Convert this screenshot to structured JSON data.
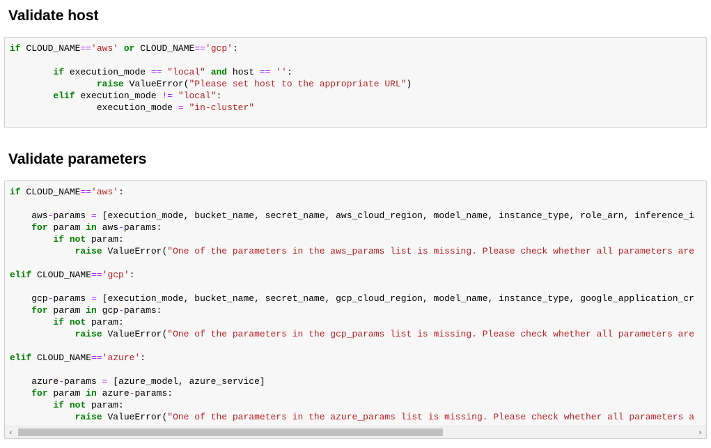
{
  "sections": [
    {
      "title": "Validate host"
    },
    {
      "title": "Validate parameters"
    }
  ],
  "code_cells": [
    {
      "lines": [
        [
          [
            "kw",
            "if"
          ],
          [
            "t",
            " CLOUD_NAME"
          ],
          [
            "op",
            "=="
          ],
          [
            "str",
            "'aws'"
          ],
          [
            "t",
            " "
          ],
          [
            "kw",
            "or"
          ],
          [
            "t",
            " CLOUD_NAME"
          ],
          [
            "op",
            "=="
          ],
          [
            "str",
            "'gcp'"
          ],
          [
            "t",
            ":"
          ]
        ],
        [],
        [
          [
            "t",
            "        "
          ],
          [
            "kw",
            "if"
          ],
          [
            "t",
            " execution_mode "
          ],
          [
            "op",
            "=="
          ],
          [
            "t",
            " "
          ],
          [
            "str",
            "\"local\""
          ],
          [
            "t",
            " "
          ],
          [
            "kw",
            "and"
          ],
          [
            "t",
            " host "
          ],
          [
            "op",
            "=="
          ],
          [
            "t",
            " "
          ],
          [
            "str",
            "''"
          ],
          [
            "t",
            ":"
          ]
        ],
        [
          [
            "t",
            "                "
          ],
          [
            "kw",
            "raise"
          ],
          [
            "t",
            " ValueError("
          ],
          [
            "str",
            "\"Please set host to the appropriate URL\""
          ],
          [
            "t",
            ")"
          ]
        ],
        [
          [
            "t",
            "        "
          ],
          [
            "kw",
            "elif"
          ],
          [
            "t",
            " execution_mode "
          ],
          [
            "op",
            "!="
          ],
          [
            "t",
            " "
          ],
          [
            "str",
            "\"local\""
          ],
          [
            "t",
            ":"
          ]
        ],
        [
          [
            "t",
            "                execution_mode "
          ],
          [
            "op",
            "="
          ],
          [
            "t",
            " "
          ],
          [
            "str",
            "\"in-cluster\""
          ]
        ]
      ]
    },
    {
      "lines": [
        [
          [
            "kw",
            "if"
          ],
          [
            "t",
            " CLOUD_NAME"
          ],
          [
            "op",
            "=="
          ],
          [
            "str",
            "'aws'"
          ],
          [
            "t",
            ":"
          ]
        ],
        [],
        [
          [
            "t",
            "    aws"
          ],
          [
            "op",
            "-"
          ],
          [
            "t",
            "params "
          ],
          [
            "op",
            "="
          ],
          [
            "t",
            " [execution_mode, bucket_name, secret_name, aws_cloud_region, model_name, instance_type, role_arn, inference_i"
          ]
        ],
        [
          [
            "t",
            "    "
          ],
          [
            "kw",
            "for"
          ],
          [
            "t",
            " param "
          ],
          [
            "kw",
            "in"
          ],
          [
            "t",
            " aws"
          ],
          [
            "op",
            "-"
          ],
          [
            "t",
            "params:"
          ]
        ],
        [
          [
            "t",
            "        "
          ],
          [
            "kw",
            "if"
          ],
          [
            "t",
            " "
          ],
          [
            "kw",
            "not"
          ],
          [
            "t",
            " param:"
          ]
        ],
        [
          [
            "t",
            "            "
          ],
          [
            "kw",
            "raise"
          ],
          [
            "t",
            " ValueError("
          ],
          [
            "str",
            "\"One of the parameters in the aws_params list is missing. Please check whether all parameters are"
          ]
        ],
        [],
        [
          [
            "kw",
            "elif"
          ],
          [
            "t",
            " CLOUD_NAME"
          ],
          [
            "op",
            "=="
          ],
          [
            "str",
            "'gcp'"
          ],
          [
            "t",
            ":"
          ]
        ],
        [],
        [
          [
            "t",
            "    gcp"
          ],
          [
            "op",
            "-"
          ],
          [
            "t",
            "params "
          ],
          [
            "op",
            "="
          ],
          [
            "t",
            " [execution_mode, bucket_name, secret_name, gcp_cloud_region, model_name, instance_type, google_application_cr"
          ]
        ],
        [
          [
            "t",
            "    "
          ],
          [
            "kw",
            "for"
          ],
          [
            "t",
            " param "
          ],
          [
            "kw",
            "in"
          ],
          [
            "t",
            " gcp"
          ],
          [
            "op",
            "-"
          ],
          [
            "t",
            "params:"
          ]
        ],
        [
          [
            "t",
            "        "
          ],
          [
            "kw",
            "if"
          ],
          [
            "t",
            " "
          ],
          [
            "kw",
            "not"
          ],
          [
            "t",
            " param:"
          ]
        ],
        [
          [
            "t",
            "            "
          ],
          [
            "kw",
            "raise"
          ],
          [
            "t",
            " ValueError("
          ],
          [
            "str",
            "\"One of the parameters in the gcp_params list is missing. Please check whether all parameters are"
          ]
        ],
        [],
        [
          [
            "kw",
            "elif"
          ],
          [
            "t",
            " CLOUD_NAME"
          ],
          [
            "op",
            "=="
          ],
          [
            "str",
            "'azure'"
          ],
          [
            "t",
            ":"
          ]
        ],
        [],
        [
          [
            "t",
            "    azure"
          ],
          [
            "op",
            "-"
          ],
          [
            "t",
            "params "
          ],
          [
            "op",
            "="
          ],
          [
            "t",
            " [azure_model, azure_service]"
          ]
        ],
        [
          [
            "t",
            "    "
          ],
          [
            "kw",
            "for"
          ],
          [
            "t",
            " param "
          ],
          [
            "kw",
            "in"
          ],
          [
            "t",
            " azure"
          ],
          [
            "op",
            "-"
          ],
          [
            "t",
            "params:"
          ]
        ],
        [
          [
            "t",
            "        "
          ],
          [
            "kw",
            "if"
          ],
          [
            "t",
            " "
          ],
          [
            "kw",
            "not"
          ],
          [
            "t",
            " param:"
          ]
        ],
        [
          [
            "t",
            "            "
          ],
          [
            "kw",
            "raise"
          ],
          [
            "t",
            " ValueError("
          ],
          [
            "str",
            "\"One of the parameters in the azure_params list is missing. Please check whether all parameters a"
          ]
        ]
      ],
      "scrollbar": {
        "left_arrow": "‹",
        "right_arrow": "›",
        "visible_fraction": 0.63,
        "position": 0
      }
    }
  ],
  "colors": {
    "keyword": "#008000",
    "operator": "#aa22ff",
    "string": "#ba2121",
    "cell_bg": "#f7f7f7",
    "cell_border": "#cfcfcf"
  }
}
